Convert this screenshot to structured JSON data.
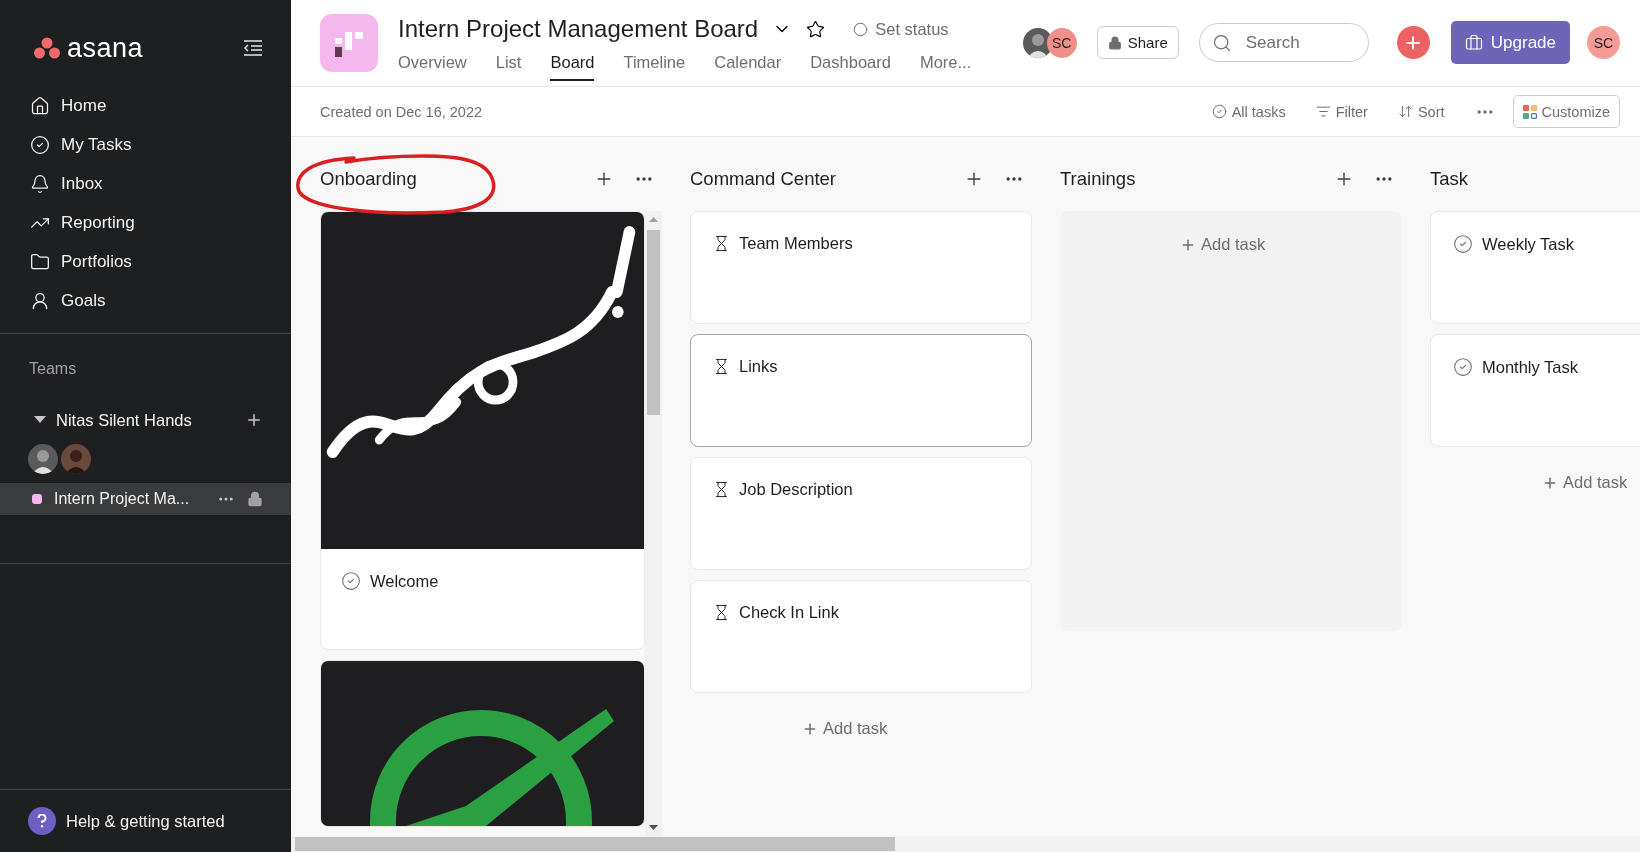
{
  "sidebar": {
    "logo": "asana",
    "nav": [
      {
        "label": "Home",
        "kind": "home",
        "selected": false
      },
      {
        "label": "My Tasks",
        "kind": "tasks",
        "selected": false
      },
      {
        "label": "Inbox",
        "kind": "inbox",
        "selected": false
      },
      {
        "label": "Reporting",
        "kind": "reporting",
        "selected": false
      },
      {
        "label": "Portfolios",
        "kind": "portfolios",
        "selected": false
      },
      {
        "label": "Goals",
        "kind": "goals",
        "selected": false
      }
    ],
    "teams_heading": "Teams",
    "team": {
      "name": "Nitas Silent Hands",
      "expanded": true,
      "members": [
        {
          "kind": "picture"
        },
        {
          "kind": "picture"
        }
      ]
    },
    "projects": [
      {
        "label": "Intern Project Ma...",
        "color": "#f5b8ee",
        "selected": true
      }
    ],
    "help": "Help & getting started"
  },
  "header": {
    "title": "Intern Project Management Board",
    "status": "Set status",
    "tabs": [
      {
        "label": "Overview",
        "selected": false
      },
      {
        "label": "List",
        "selected": false
      },
      {
        "label": "Board",
        "selected": true
      },
      {
        "label": "Timeline",
        "selected": false
      },
      {
        "label": "Calendar",
        "selected": false
      },
      {
        "label": "Dashboard",
        "selected": false
      },
      {
        "label": "More...",
        "selected": false
      }
    ],
    "members": [
      {
        "kind": "picture"
      },
      {
        "kind": "initials",
        "initials": "SC"
      }
    ],
    "share": "Share",
    "search": {
      "placeholder": "Search"
    },
    "upgrade": "Upgrade",
    "user": "SC"
  },
  "toolbar": {
    "created": "Created on Dec 16, 2022",
    "actions": [
      {
        "label": "All tasks",
        "kind": "check"
      },
      {
        "label": "Filter",
        "kind": "filter"
      },
      {
        "label": "Sort",
        "kind": "sort"
      }
    ],
    "customize": "Customize"
  },
  "columns": [
    {
      "title": "Onboarding",
      "circled": true,
      "scrollbar": true,
      "cards": [
        {
          "kind": "task",
          "title": "Welcome",
          "cover": true,
          "selected": false
        },
        {
          "cover": true,
          "selected": false
        }
      ]
    },
    {
      "title": "Command Center",
      "add_task": "Add task",
      "cards": [
        {
          "kind": "approval",
          "title": "Team Members",
          "selected": false
        },
        {
          "kind": "approval",
          "title": "Links",
          "selected": true
        },
        {
          "kind": "approval",
          "title": "Job Description",
          "selected": false
        },
        {
          "kind": "approval",
          "title": "Check In Link",
          "selected": false
        }
      ]
    },
    {
      "title": "Trainings",
      "empty_add_task": "Add task"
    },
    {
      "title": "Task",
      "add_task": "Add task",
      "cards": [
        {
          "kind": "task",
          "title": "Weekly Task",
          "selected": false
        },
        {
          "kind": "task",
          "title": "Monthly Task",
          "selected": false
        }
      ]
    }
  ]
}
